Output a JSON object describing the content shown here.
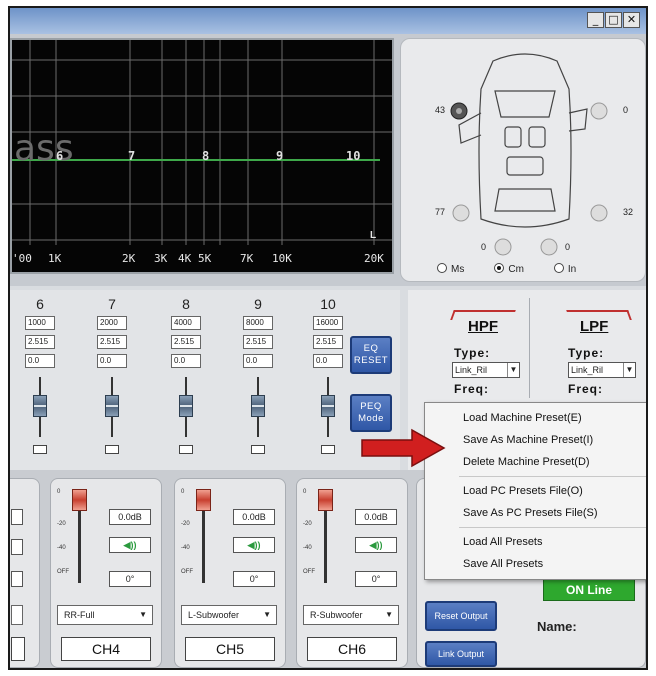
{
  "window": {
    "min_label": "_",
    "max_label": "□",
    "close_label": "✕"
  },
  "eq_graph": {
    "bg_text": "ass",
    "points": [
      "6",
      "7",
      "8",
      "9",
      "10"
    ],
    "freq_labels": [
      "'00",
      "1K",
      "2K",
      "3K",
      "4K",
      "5K",
      "7K",
      "10K",
      "20K"
    ],
    "corner_label": "L",
    "curve_color": "#3ea84a"
  },
  "speakers": {
    "left_top": "43",
    "right_top": "0",
    "left_mid": "77",
    "right_mid": "32",
    "bottom_left": "0",
    "bottom_right": "0",
    "units": [
      {
        "label": "Ms",
        "selected": false
      },
      {
        "label": "Cm",
        "selected": true
      },
      {
        "label": "In",
        "selected": false
      }
    ]
  },
  "bands": [
    {
      "num": "6",
      "freq": "1000",
      "q": "2.515",
      "gain": "0.0"
    },
    {
      "num": "7",
      "freq": "2000",
      "q": "2.515",
      "gain": "0.0"
    },
    {
      "num": "8",
      "freq": "4000",
      "q": "2.515",
      "gain": "0.0"
    },
    {
      "num": "9",
      "freq": "8000",
      "q": "2.515",
      "gain": "0.0"
    },
    {
      "num": "10",
      "freq": "16000",
      "q": "2.515",
      "gain": "0.0"
    }
  ],
  "eq_reset": {
    "line1": "EQ",
    "line2": "RESET"
  },
  "peq_mode": {
    "line1": "PEQ",
    "line2": "Mode"
  },
  "hpf": {
    "title": "HPF",
    "type_label": "Type:",
    "type_value": "Link_Ril",
    "freq_label": "Freq:"
  },
  "lpf": {
    "title": "LPF",
    "type_label": "Type:",
    "type_value": "Link_Ril",
    "freq_label": "Freq:"
  },
  "channels": [
    {
      "gain": "0.0dB",
      "speaker": "◀))",
      "phase": "0°",
      "output": "RR-Full",
      "label": "CH4"
    },
    {
      "gain": "0.0dB",
      "speaker": "◀))",
      "phase": "0°",
      "output": "L-Subwoofer",
      "label": "CH5"
    },
    {
      "gain": "0.0dB",
      "speaker": "◀))",
      "phase": "0°",
      "output": "R-Subwoofer",
      "label": "CH6"
    }
  ],
  "scale": {
    "top": "0",
    "mid1": "-20",
    "mid2": "-40",
    "bottom": "OFF"
  },
  "reset_output": "Reset Output",
  "link_output": "Link Output",
  "online": "ON Line",
  "name_label": "Name:",
  "context_menu": {
    "items_group1": [
      "Load Machine Preset(E)",
      "Save As Machine Preset(I)",
      "Delete Machine Preset(D)"
    ],
    "items_group2": [
      "Load PC Presets File(O)",
      "Save As PC Presets File(S)"
    ],
    "items_group3": [
      "Load All Presets",
      "Save All Presets"
    ]
  }
}
